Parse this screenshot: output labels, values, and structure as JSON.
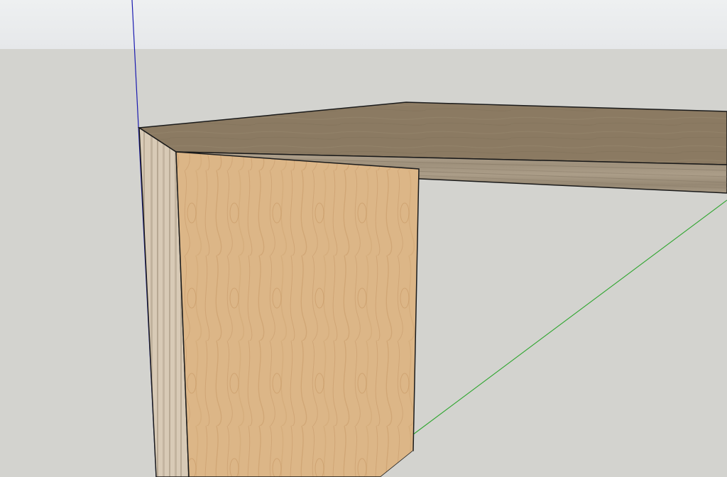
{
  "viewport": {
    "sky_color": "#eaecee",
    "ground_color": "#d3d3cf"
  },
  "axes": {
    "blue_axis_color": "#1b1bb0",
    "green_axis_color": "#2fa62f"
  },
  "model": {
    "component": "plywood-table",
    "top_surface_color": "#8b7a62",
    "top_edge_color": "#a49682",
    "leg_face_color": "#ddb88a",
    "leg_edge_color": "#d6c8b4",
    "outline_color": "#1a1a1a"
  }
}
